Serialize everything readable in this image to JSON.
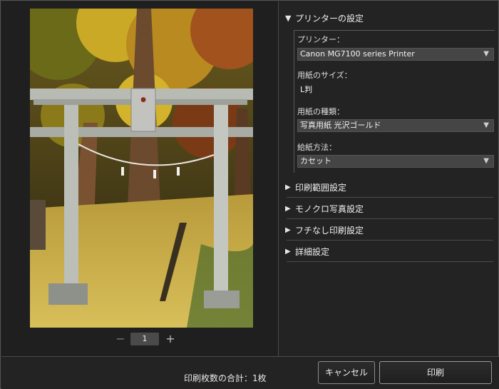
{
  "preview": {
    "photo_icon": "torii-gate-photo",
    "pager": {
      "prev_label": "−",
      "page_number": "1",
      "next_label": "+"
    }
  },
  "settings": {
    "printer_section": {
      "title": "プリンターの設定",
      "printer_label": "プリンター：",
      "printer_value": "Canon MG7100 series Printer",
      "paper_size_label": "用紙のサイズ：",
      "paper_size_value": "L判",
      "media_type_label": "用紙の種類：",
      "media_type_value": "写真用紙 光沢ゴールド",
      "paper_source_label": "給紙方法：",
      "paper_source_value": "カセット"
    },
    "collapsed_sections": [
      {
        "title": "印刷範囲設定"
      },
      {
        "title": "モノクロ写真設定"
      },
      {
        "title": "フチなし印刷設定"
      },
      {
        "title": "詳細設定"
      }
    ]
  },
  "footer": {
    "total_text": "印刷枚数の合計：1枚",
    "cancel_label": "キャンセル",
    "print_label": "印刷"
  },
  "colors": {
    "background": "#232323",
    "select_bg": "#454545",
    "text": "#e8e8e8"
  }
}
